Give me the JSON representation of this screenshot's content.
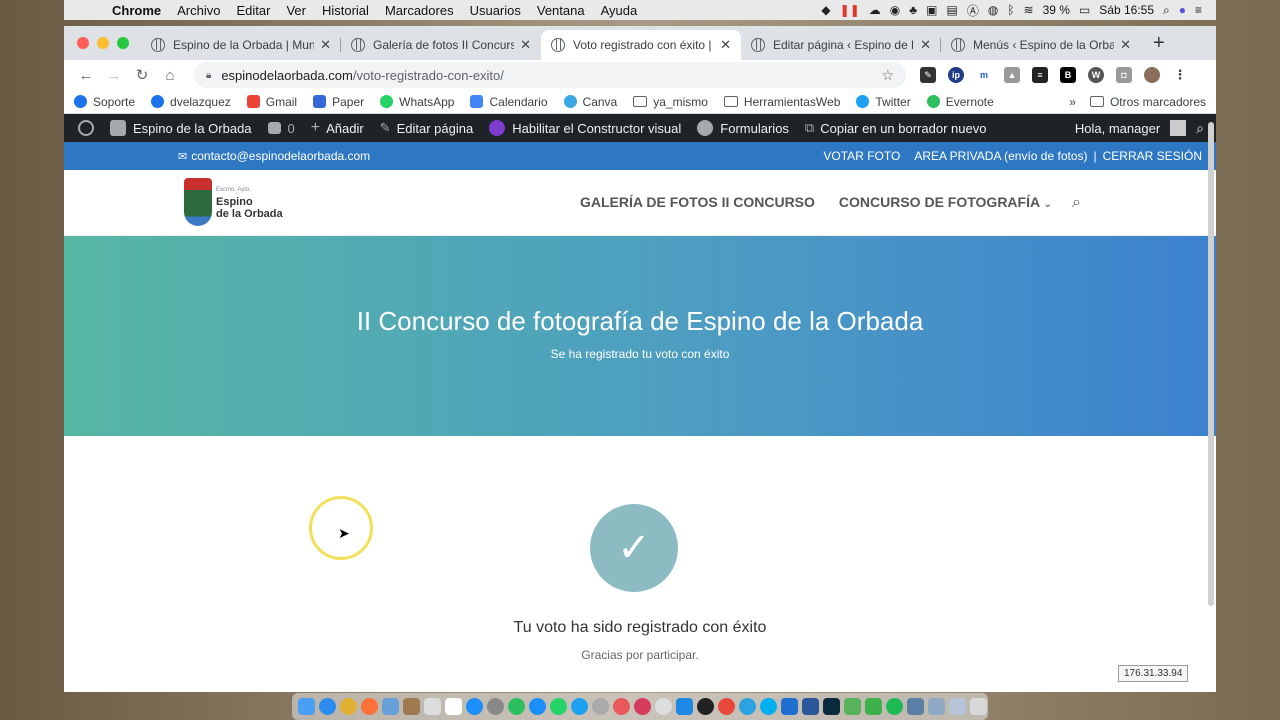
{
  "menubar": {
    "app_name": "Chrome",
    "items": [
      "Archivo",
      "Editar",
      "Ver",
      "Historial",
      "Marcadores",
      "Usuarios",
      "Ventana",
      "Ayuda"
    ],
    "battery": "39 %",
    "clock": "Sáb 16:55"
  },
  "tabs": [
    {
      "title": "Espino de la Orbada | Munic",
      "active": false
    },
    {
      "title": "Galería de fotos II Concurso",
      "active": false
    },
    {
      "title": "Voto registrado con éxito | E",
      "active": true
    },
    {
      "title": "Editar página ‹ Espino de la",
      "active": false
    },
    {
      "title": "Menús ‹ Espino de la Orbad",
      "active": false
    }
  ],
  "address": {
    "domain": "espinodelaorbada.com",
    "path": "/voto-registrado-con-exito/"
  },
  "bookmarks": {
    "items": [
      {
        "label": "Soporte",
        "color": "#1a73e8",
        "type": "site"
      },
      {
        "label": "dvelazquez",
        "color": "#1a73e8",
        "type": "site"
      },
      {
        "label": "Gmail",
        "color": "#ea4335",
        "type": "site"
      },
      {
        "label": "Paper",
        "color": "#3867d6",
        "type": "site"
      },
      {
        "label": "WhatsApp",
        "color": "#25d366",
        "type": "site"
      },
      {
        "label": "Calendario",
        "color": "#4285f4",
        "type": "site"
      },
      {
        "label": "Canva",
        "color": "#3ba8e6",
        "type": "site"
      },
      {
        "label": "ya_mismo",
        "color": "#5f6368",
        "type": "folder"
      },
      {
        "label": "HerramientasWeb",
        "color": "#5f6368",
        "type": "folder"
      },
      {
        "label": "Twitter",
        "color": "#1da1f2",
        "type": "site"
      },
      {
        "label": "Evernote",
        "color": "#2dbe60",
        "type": "site"
      }
    ],
    "more": "»",
    "other": "Otros marcadores"
  },
  "wpbar": {
    "site": "Espino de la Orbada",
    "comments": "0",
    "add": "Añadir",
    "edit": "Editar página",
    "builder": "Habilitar el Constructor visual",
    "forms": "Formularios",
    "copy": "Copiar en un borrador nuevo",
    "greeting": "Hola, manager"
  },
  "sitetop": {
    "email": "contacto@espinodelaorbada.com",
    "links": [
      "VOTAR FOTO",
      "AREA PRIVADA (envío de fotos)",
      "|",
      "CERRAR SESIÓN"
    ]
  },
  "logo": {
    "small": "Excmo. Ayto.",
    "line1": "Espino",
    "line2": "de la Orbada"
  },
  "nav": {
    "gallery": "GALERÍA DE FOTOS II CONCURSO",
    "contest": "CONCURSO DE FOTOGRAFÍA"
  },
  "hero": {
    "title": "II Concurso de fotografía de Espino de la Orbada",
    "subtitle": "Se ha registrado tu voto con éxito"
  },
  "content": {
    "check": "✓",
    "message": "Tu voto ha sido registrado con éxito",
    "thanks": "Gracias por participar."
  },
  "overlay": {
    "ip": "176.31.33.94"
  },
  "colors": {
    "wp_bar": "#1d2327",
    "site_blue": "#2e77c2",
    "hero_start": "#56b7a4",
    "hero_end": "#3c82cf",
    "check_circle": "#8dbbc2"
  }
}
